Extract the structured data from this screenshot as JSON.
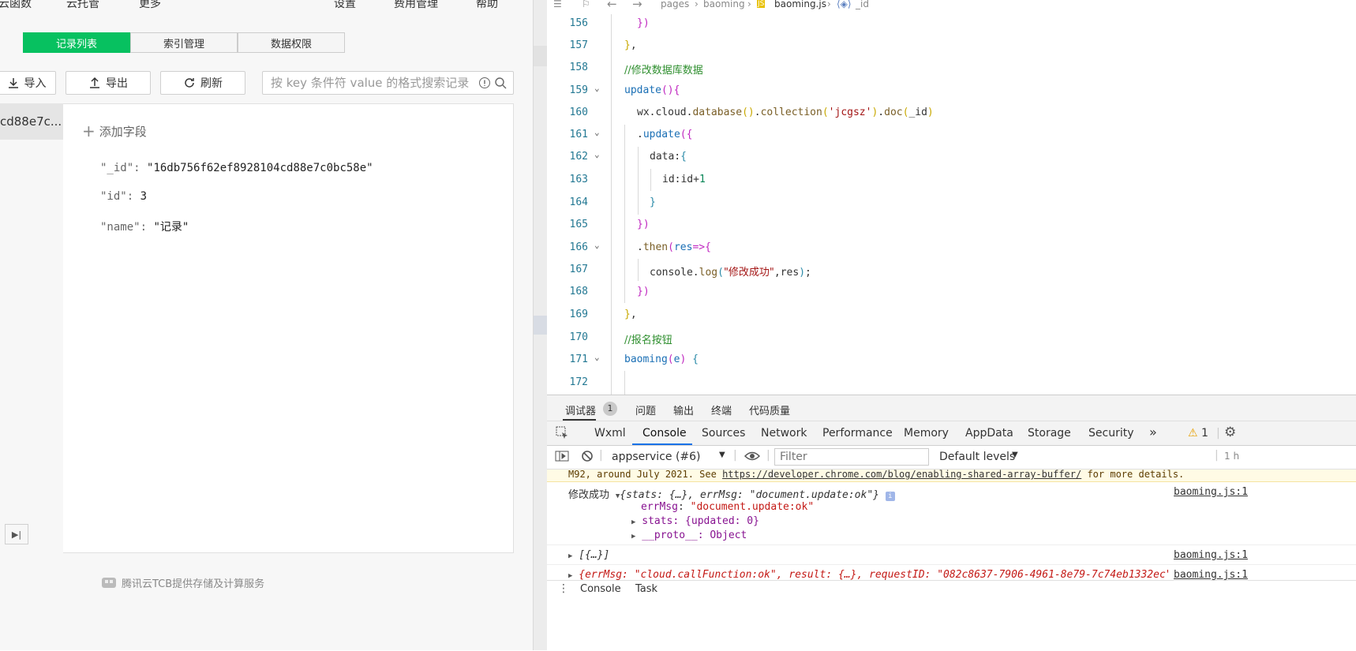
{
  "left": {
    "topnav": [
      "云函数",
      "云托管",
      "更多",
      "设置",
      "费用管理",
      "帮助"
    ],
    "tabs": [
      "记录列表",
      "索引管理",
      "数据权限"
    ],
    "toolbar": {
      "import": "导入",
      "export": "导出",
      "refresh": "刷新"
    },
    "search_placeholder": "按 key 条件符 value 的格式搜索记录",
    "selected_record": "cd88e7c...",
    "add_field": "添加字段",
    "fields": [
      {
        "key": "\"_id\":",
        "value": "\"16db756f62ef8928104cd88e7c0bc58e\""
      },
      {
        "key": "\"id\":",
        "value": "3"
      },
      {
        "key": "\"name\":",
        "value": "\"记录\""
      }
    ],
    "footer": "腾讯云TCB提供存储及计算服务"
  },
  "editor": {
    "breadcrumb": [
      "pages",
      "baoming",
      "baoming.js",
      "_id"
    ],
    "line_numbers": [
      "156",
      "157",
      "158",
      "159",
      "160",
      "161",
      "162",
      "163",
      "164",
      "165",
      "166",
      "167",
      "168",
      "169",
      "170",
      "171",
      "172"
    ],
    "comments": {
      "c158": "//修改数据库数据",
      "c170": "//报名按钮"
    },
    "strings": {
      "collection": "'jcgsz'",
      "log": "\"修改成功\""
    }
  },
  "devtools": {
    "panel_tabs": [
      "调试器",
      "问题",
      "输出",
      "终端",
      "代码质量"
    ],
    "badge": "1",
    "tabs": [
      "Wxml",
      "Console",
      "Sources",
      "Network",
      "Performance",
      "Memory",
      "AppData",
      "Storage",
      "Security"
    ],
    "warn_count": "1",
    "context": "appservice (#6)",
    "filter_placeholder": "Filter",
    "levels": "Default levels",
    "warning_text_pre": "M92, around July 2021. See ",
    "warning_link": "https://developer.chrome.com/blog/enabling-shared-array-buffer/",
    "warning_text_post": " for more details.",
    "log_label": "修改成功",
    "log_summary": "{stats: {…}, errMsg: \"document.update:ok\"}",
    "log_errmsg_key": "errMsg",
    "log_errmsg_val": "\"document.update:ok\"",
    "log_stats": "stats: {updated: 0}",
    "log_proto": "__proto__: Object",
    "log2": "[{…}]",
    "log3": "{errMsg: \"cloud.callFunction:ok\", result: {…}, requestID: \"082c8637-7906-4961-8e79-7c74eb1332ec\"}",
    "source": "baoming.js:1",
    "drawer_tabs": [
      "Console",
      "Task"
    ]
  }
}
